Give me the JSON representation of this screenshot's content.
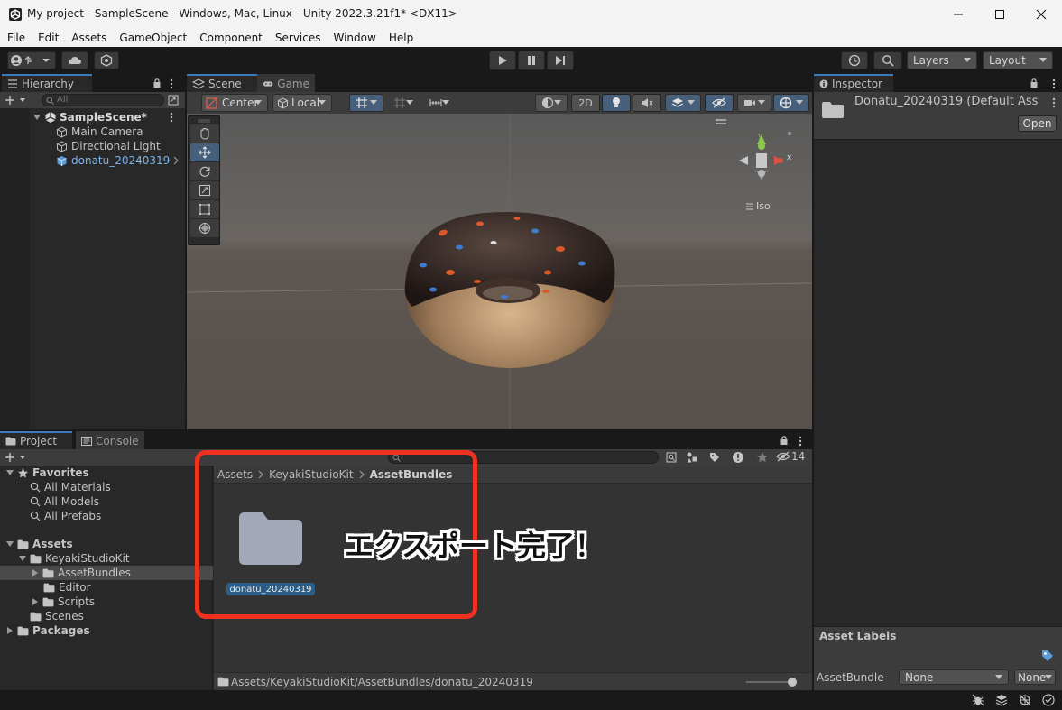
{
  "window": {
    "title": "My project - SampleScene - Windows, Mac, Linux - Unity 2022.3.21f1* <DX11>"
  },
  "menu": [
    "File",
    "Edit",
    "Assets",
    "GameObject",
    "Component",
    "Services",
    "Window",
    "Help"
  ],
  "toolbar": {
    "layers_label": "Layers",
    "layout_label": "Layout"
  },
  "hierarchy": {
    "tab": "Hierarchy",
    "search_placeholder": "All",
    "scene": "SampleScene*",
    "items": [
      "Main Camera",
      "Directional Light",
      "donatu_20240319"
    ]
  },
  "scene": {
    "tab_scene": "Scene",
    "tab_game": "Game",
    "pivot_label": "Center",
    "space_label": "Local",
    "mode_2d": "2D",
    "iso_label": "Iso",
    "gizmo_x": "x",
    "gizmo_y": "y"
  },
  "project": {
    "tab_project": "Project",
    "tab_console": "Console",
    "hidden_count": "14",
    "favorites": {
      "label": "Favorites",
      "items": [
        "All Materials",
        "All Models",
        "All Prefabs"
      ]
    },
    "assets": {
      "label": "Assets",
      "keyaki": "KeyakiStudioKit",
      "asset_bundles": "AssetBundles",
      "editor": "Editor",
      "scripts": "Scripts",
      "scenes": "Scenes"
    },
    "packages": "Packages",
    "breadcrumb": [
      "Assets",
      "KeyakiStudioKit",
      "AssetBundles"
    ],
    "folder_item": "donatu_20240319",
    "status_path": "Assets/KeyakiStudioKit/AssetBundles/donatu_20240319"
  },
  "annotation": {
    "text": "エクスポート完了！",
    "highlight_color": "#f0311f"
  },
  "inspector": {
    "tab": "Inspector",
    "asset_name": "Donatu_20240319 (Default Ass",
    "open_button": "Open",
    "asset_labels": "Asset Labels",
    "asset_bundle_label": "AssetBundle",
    "bundle_value": "None",
    "variant_value": "None"
  },
  "colors": {
    "selection": "#2c5d87",
    "accent_tab": "#3a79bb",
    "panel_bg": "#282828"
  }
}
